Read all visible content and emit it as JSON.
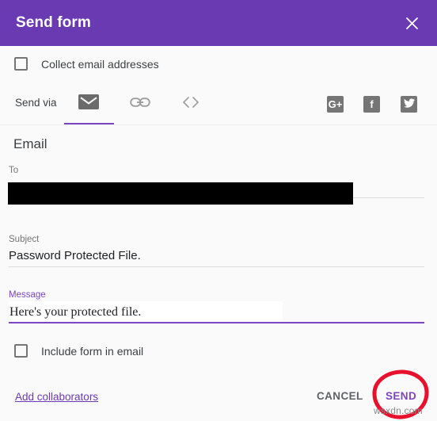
{
  "header": {
    "title": "Send form",
    "close_icon": "close-icon",
    "background_color": "#6A3AB2"
  },
  "collect_email": {
    "label": "Collect email addresses",
    "checked": false
  },
  "send_via": {
    "label": "Send via",
    "tabs": [
      {
        "name": "email",
        "icon": "envelope-icon",
        "active": true
      },
      {
        "name": "link",
        "icon": "link-icon",
        "active": false
      },
      {
        "name": "embed",
        "icon": "embed-code-icon",
        "active": false,
        "glyph": "< >"
      }
    ],
    "social": [
      {
        "name": "google-plus",
        "glyph": "G+"
      },
      {
        "name": "facebook",
        "glyph": "f"
      },
      {
        "name": "twitter",
        "glyph": "twitter-bird-icon"
      }
    ]
  },
  "email_section": {
    "title": "Email",
    "to": {
      "label": "To",
      "value": "",
      "redacted": true
    },
    "subject": {
      "label": "Subject",
      "value": "Password Protected File."
    },
    "message": {
      "label": "Message",
      "value": "Here's your protected file.",
      "focused": true
    }
  },
  "include_form": {
    "label": "Include form in email",
    "checked": false
  },
  "footer": {
    "collaborators_link": "Add collaborators",
    "cancel_label": "CANCEL",
    "send_label": "SEND"
  },
  "annotation": {
    "highlight_color": "#E8112D",
    "target": "SEND"
  },
  "watermark": {
    "text": "wsxdn.com"
  },
  "colors": {
    "accent": "#7B45C4",
    "header": "#6A3AB2",
    "background": "#fafafa"
  }
}
